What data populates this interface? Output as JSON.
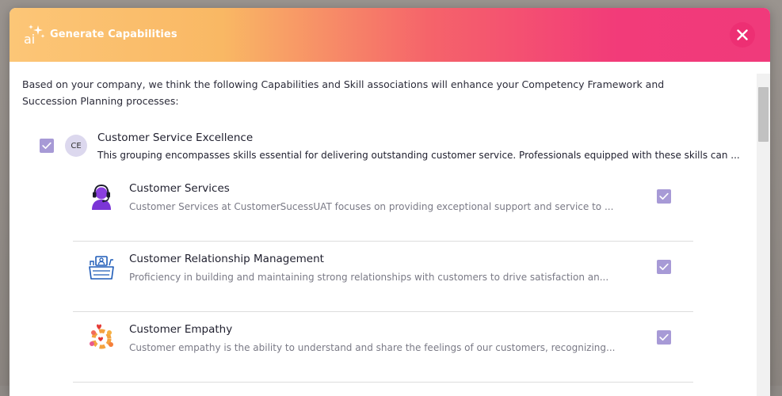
{
  "modal": {
    "title": "Generate Capabilities",
    "intro": "Based on your company, we think the following Capabilities and Skill associations will enhance your Competency Framework and Succession Planning processes:"
  },
  "group": {
    "avatar_initials": "CE",
    "title": "Customer Service Excellence",
    "description": "This grouping encompasses skills essential for delivering outstanding customer service. Professionals equipped with these skills can ...",
    "checked": true
  },
  "skills": [
    {
      "title": "Customer Services",
      "description": "Customer Services at CustomerSucessUAT focuses on providing exceptional support and service to ...",
      "icon": "headset-agent-icon",
      "checked": true
    },
    {
      "title": "Customer Relationship Management",
      "description": "Proficiency in building and maintaining strong relationships with customers to drive satisfaction an...",
      "icon": "crm-desk-icon",
      "checked": true
    },
    {
      "title": "Customer Empathy",
      "description": "Customer empathy is the ability to understand and share the feelings of our customers, recognizing...",
      "icon": "empathy-hearts-icon",
      "checked": true
    }
  ],
  "colors": {
    "header_gradient_start": "#fcc677",
    "header_gradient_end": "#f03a7b",
    "checkbox": "#a79ad6",
    "avatar_bg": "#dcd8ee"
  }
}
